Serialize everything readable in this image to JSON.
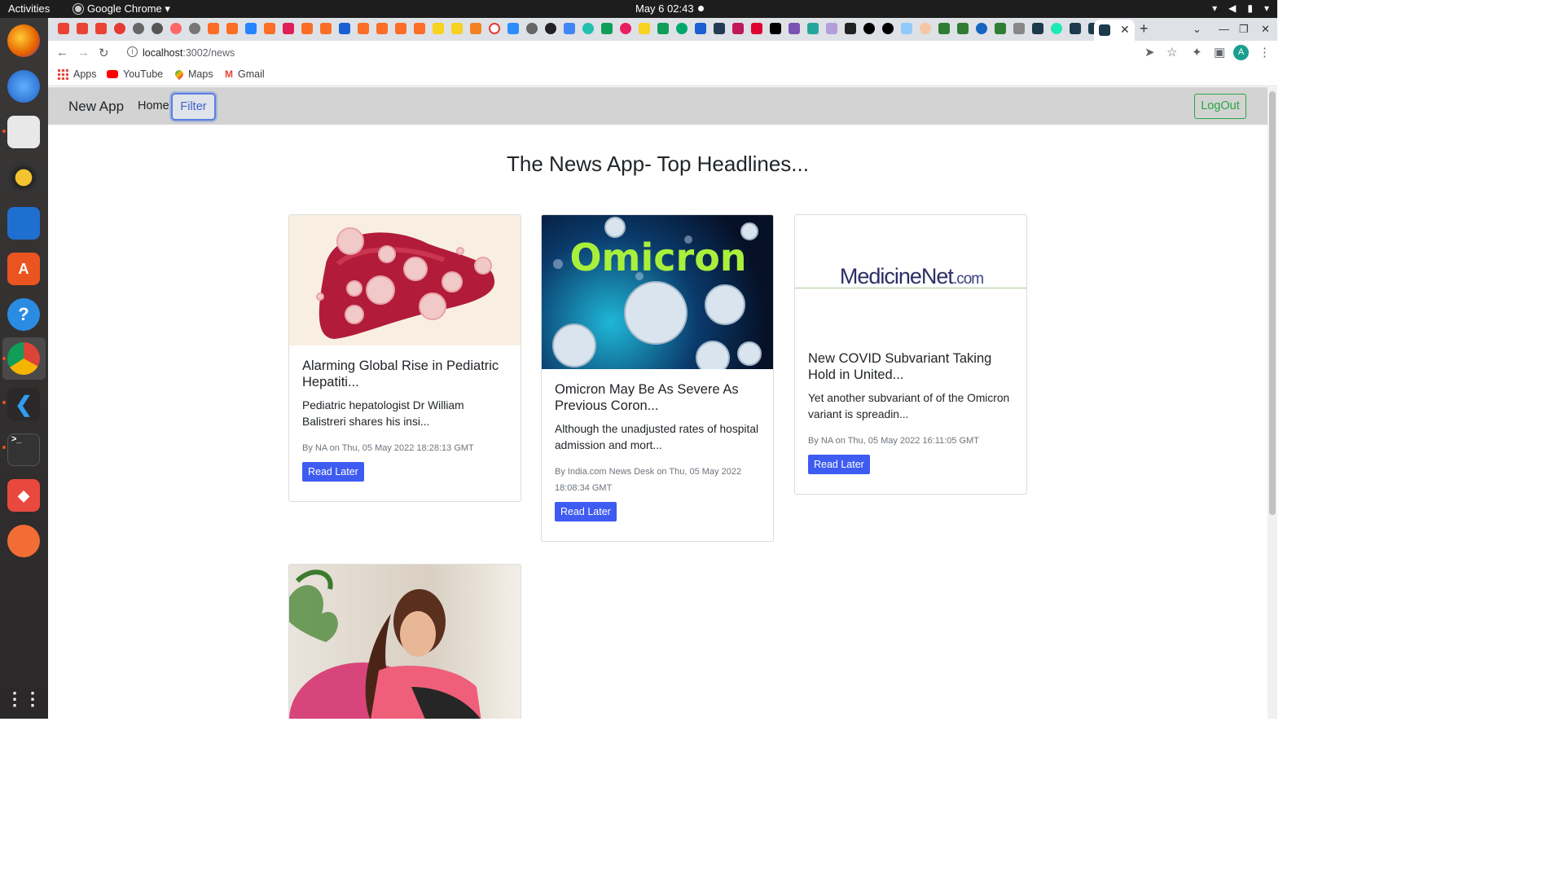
{
  "os": {
    "activities": "Activities",
    "app_menu": "Google Chrome ▾",
    "clock": "May 6  02:43"
  },
  "browser": {
    "url_host": "localhost",
    "url_path": ":3002/news",
    "bookmarks": [
      {
        "label": "Apps",
        "icon": "apps-grid-icon"
      },
      {
        "label": "YouTube",
        "icon": "youtube-icon"
      },
      {
        "label": "Maps",
        "icon": "maps-pin-icon"
      },
      {
        "label": "Gmail",
        "icon": "gmail-icon"
      }
    ],
    "active_tab_close": "✕",
    "new_tab": "+"
  },
  "navbar": {
    "brand": "New App",
    "home": "Home",
    "filter": "Filter",
    "logout": "LogOut"
  },
  "page": {
    "title": "The News App- Top Headlines..."
  },
  "articles": [
    {
      "title": "Alarming Global Rise in Pediatric Hepatiti...",
      "description": "Pediatric hepatologist Dr William Balistreri shares his insi...",
      "meta": "By NA on Thu, 05 May 2022 18:28:13 GMT",
      "button": "Read Later",
      "image": "liver-virus-illustration"
    },
    {
      "title": "Omicron May Be As Severe As Previous Coron...",
      "description": "Although the unadjusted rates of hospital admission and mort...",
      "meta": "By India.com News Desk on Thu, 05 May 2022 18:08:34 GMT",
      "button": "Read Later",
      "image": "omicron-virus-image",
      "image_text": "Omicron"
    },
    {
      "title": "New COVID Subvariant Taking Hold in United...",
      "description": "Yet another subvariant of of the Omicron variant is spreadin...",
      "meta": "By NA on Thu, 05 May 2022 16:11:05 GMT",
      "button": "Read Later",
      "image": "medicinenet-logo",
      "image_text_main": "MedicineNet",
      "image_text_suffix": ".com"
    },
    {
      "image": "woman-photo"
    }
  ],
  "colors": {
    "navbar_bg": "#d3d3d3",
    "primary_button": "#3e5bf2",
    "logout_green": "#28a745",
    "filter_focus": "#5a7ee0"
  }
}
